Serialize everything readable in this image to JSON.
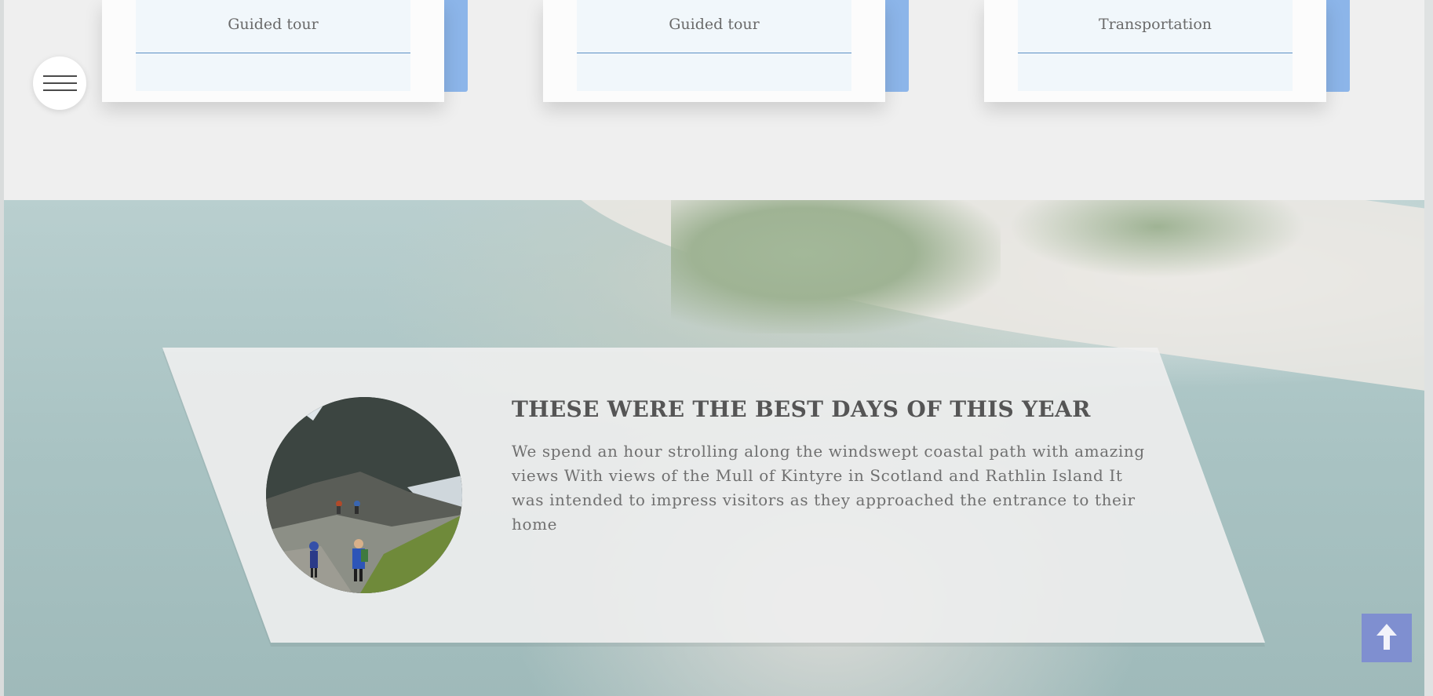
{
  "services": [
    {
      "label": "Guided tour"
    },
    {
      "label": "Guided tour"
    },
    {
      "label": "Transportation"
    }
  ],
  "feature": {
    "title": "THESE WERE THE BEST DAYS OF THIS YEAR",
    "text": "  We spend an hour strolling along the windswept coastal path with amazing views With views of the Mull of Kintyre in Scotland and Rathlin Island It was intended to impress visitors as they approached the entrance to their home"
  },
  "icons": {
    "menu": "hamburger-menu-icon",
    "scroll_top": "arrow-up-icon"
  },
  "colors": {
    "accent": "#8cb5e9",
    "card_rule": "#5b8fc4",
    "scroll_top_bg": "#7f8fd0",
    "heading": "#555555"
  }
}
